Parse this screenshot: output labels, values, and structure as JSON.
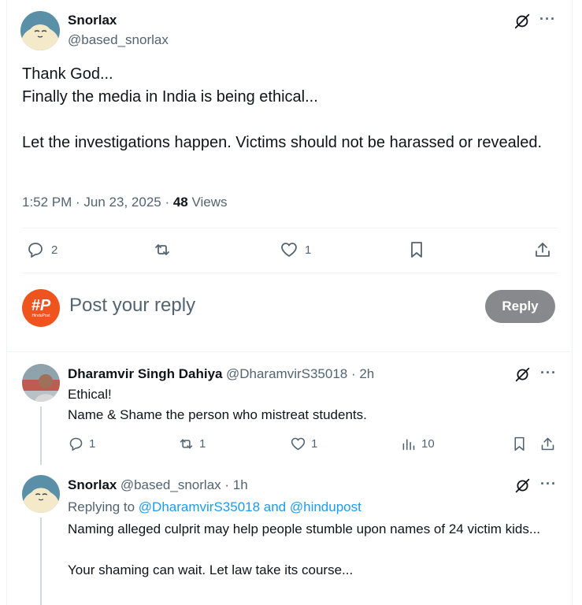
{
  "main_post": {
    "name": "Snorlax",
    "handle": "@based_snorlax",
    "text": "Thank God...\nFinally the media in India is being ethical...\n\nLet the investigations happen. Victims should not be harassed or revealed.",
    "time": "1:52 PM · Jun 23, 2025 · ",
    "views_count": "48",
    "views_label": " Views",
    "replies": "2",
    "reposts": "",
    "likes": "1",
    "more": "···"
  },
  "composer": {
    "placeholder": "Post your reply",
    "button": "Reply",
    "avatar_text": "#P",
    "avatar_sub": "HinduPost"
  },
  "replies": [
    {
      "name": "Dharamvir Singh Dahiya",
      "handle": "@DharamvirS35018 · 2h",
      "text": "Ethical!\nName & Shame the person who mistreat students.",
      "replies": "1",
      "reposts": "1",
      "likes": "1",
      "views": "10",
      "more": "···"
    },
    {
      "name": "Snorlax",
      "handle": "@based_snorlax · 1h",
      "replying_prefix": "Replying to ",
      "replying_to": "@DharamvirS35018 and @hindupost",
      "text": "Naming alleged culprit may help people stumble upon names of 24 victim kids...\n\nYour shaming can wait. Let law take its course...",
      "more": "···"
    }
  ],
  "colors": {
    "accent": "#1d9bf0",
    "reply_button": "#87898c",
    "composer_avatar": "#f0541e"
  }
}
